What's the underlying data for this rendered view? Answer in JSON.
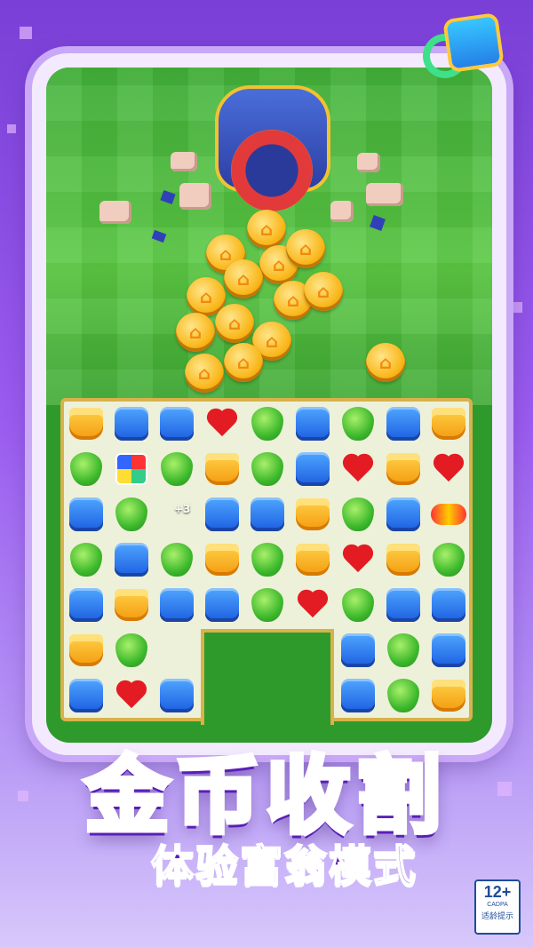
{
  "title": "金币收割",
  "subtitle": "体验富翁模式",
  "bonus_text": "+3",
  "age_rating": {
    "number": "12+",
    "org": "CADPA",
    "label": "适龄提示"
  },
  "icons": {
    "shuffle": "shuffle-icon",
    "cannon": "coin-cannon-icon",
    "coin": "house-coin-icon"
  },
  "colors": {
    "background": "#8d4ee8",
    "grass": "#4cbc3c",
    "board_border": "#d8b24a",
    "title_fill": "#7ef3ff",
    "subtitle": "#5a1fb8"
  },
  "board": {
    "rows": [
      [
        "pot",
        "blue",
        "blue",
        "heart",
        "green",
        "blue",
        "green",
        "blue",
        "pot"
      ],
      [
        "green",
        "cube",
        "green",
        "pot",
        "green",
        "blue",
        "heart",
        "pot",
        "heart"
      ],
      [
        "blue",
        "green",
        "",
        "blue",
        "blue",
        "pot",
        "green",
        "blue",
        "rocket"
      ],
      [
        "green",
        "blue",
        "green",
        "pot",
        "green",
        "pot",
        "heart",
        "pot",
        "green"
      ],
      [
        "blue",
        "pot",
        "blue",
        "blue",
        "green",
        "heart",
        "green",
        "blue",
        "blue"
      ],
      [
        "pot",
        "green",
        "",
        "",
        "",
        "",
        "blue",
        "green",
        "blue"
      ],
      [
        "blue",
        "heart",
        "blue",
        "",
        "",
        "",
        "blue",
        "green",
        "pot"
      ]
    ]
  }
}
